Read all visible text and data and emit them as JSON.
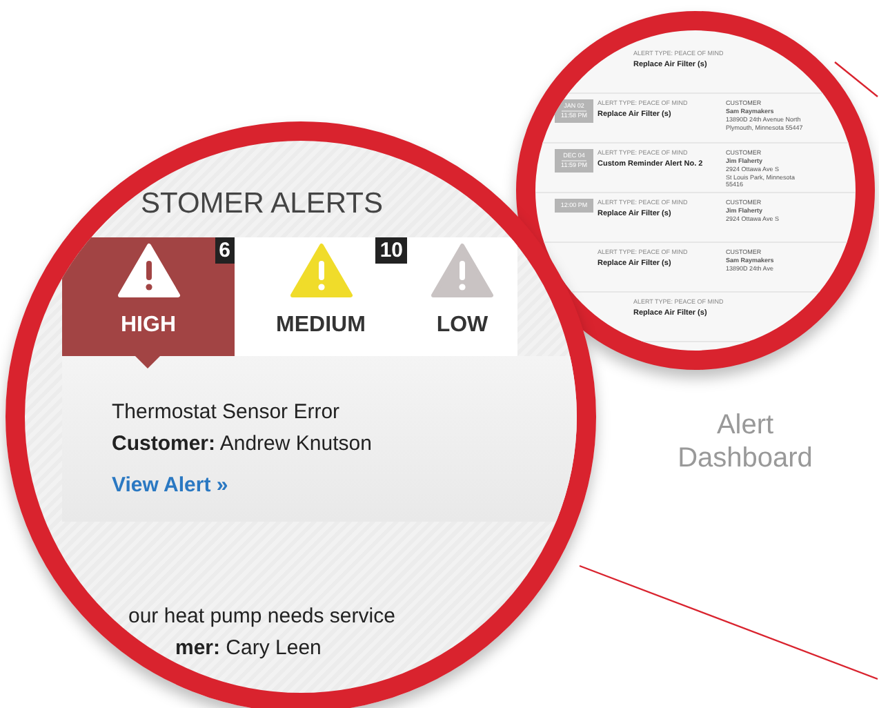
{
  "dashboard_zoom": {
    "heading": "STOMER ALERTS",
    "tabs": [
      {
        "label": "HIGH",
        "count": "6",
        "kind": "high",
        "selected": true
      },
      {
        "label": "MEDIUM",
        "count": "10",
        "kind": "medium",
        "selected": false
      },
      {
        "label": "LOW",
        "kind": "low",
        "selected": false
      }
    ],
    "alerts": [
      {
        "title": "Thermostat Sensor Error",
        "customer": "**Customer:** Andrew Knutson",
        "link": "View Alert »"
      },
      {
        "title": "our heat pump needs service",
        "customer": "**mer:** Cary Leen"
      }
    ]
  },
  "list_zoom": {
    "rows": [
      {
        "type": "ALERT TYPE: PEACE OF MIND",
        "title": "Replace Air Filter (s)"
      },
      {
        "date": "JAN 02",
        "time": "11:58 PM",
        "type": "ALERT TYPE: PEACE OF MIND",
        "title": "Replace Air Filter (s)",
        "customer_label": "CUSTOMER",
        "customer_lines": [
          "Sam Raymakers",
          "13890D 24th Avenue North",
          "Plymouth, Minnesota 55447"
        ]
      },
      {
        "date": "DEC 04",
        "time": "11:59 PM",
        "type": "ALERT TYPE: PEACE OF MIND",
        "title": "Custom Reminder Alert No. 2",
        "customer_label": "CUSTOMER",
        "customer_lines": [
          "Jim Flaherty",
          "2924 Ottawa Ave S",
          "St Louis Park, Minnesota 55416"
        ]
      },
      {
        "time": "12:00 PM",
        "type": "ALERT TYPE: PEACE OF MIND",
        "title": "Replace Air Filter (s)",
        "customer_label": "CUSTOMER",
        "customer_lines": [
          "Jim Flaherty",
          "2924 Ottawa Ave S"
        ]
      },
      {
        "type": "ALERT TYPE: PEACE OF MIND",
        "title": "Replace Air Filter (s)",
        "customer_label": "CUSTOMER",
        "customer_lines": [
          "Sam Raymakers",
          "13890D 24th Ave"
        ]
      },
      {
        "type": "ALERT TYPE: PEACE OF MIND",
        "title": "Replace Air Filter (s)"
      }
    ]
  },
  "caption": "Alert Dashboard"
}
